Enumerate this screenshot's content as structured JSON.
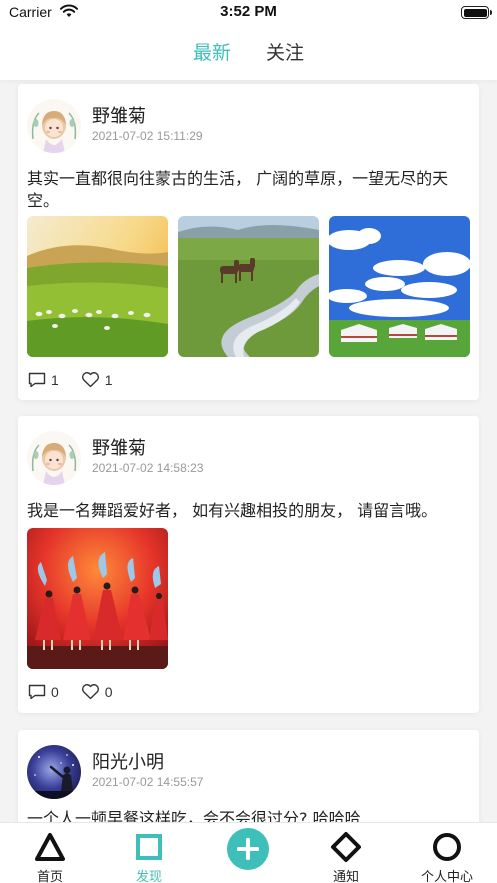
{
  "status_bar": {
    "carrier": "Carrier",
    "time": "3:52 PM"
  },
  "top_tabs": {
    "latest": "最新",
    "follow": "关注"
  },
  "posts": [
    {
      "username": "野雏菊",
      "time": "2021-07-02 15:11:29",
      "text": "其实一直都很向往蒙古的生活， 广阔的草原，一望无尽的天空。",
      "photos": [
        "grassland-sheep-photo",
        "horses-river-photo",
        "yurts-blue-sky-photo"
      ],
      "comments": "1",
      "likes": "1"
    },
    {
      "username": "野雏菊",
      "time": "2021-07-02 14:58:23",
      "text": "我是一名舞蹈爱好者， 如有兴趣相投的朋友， 请留言哦。",
      "photos": [
        "dancers-stage-photo"
      ],
      "comments": "0",
      "likes": "0"
    },
    {
      "username": "阳光小明",
      "time": "2021-07-02 14:55:57",
      "text": "一个人一顿早餐这样吃，会不会很过分? 哈哈哈"
    }
  ],
  "bottom_nav": [
    {
      "label": "首页",
      "icon": "triangle-icon"
    },
    {
      "label": "发现",
      "icon": "square-icon",
      "active": true
    },
    {
      "label": "",
      "icon": "plus-circle-icon"
    },
    {
      "label": "通知",
      "icon": "diamond-icon"
    },
    {
      "label": "个人中心",
      "icon": "circle-icon"
    }
  ],
  "colors": {
    "accent": "#3fbfb9",
    "background": "#f3f3f3"
  }
}
